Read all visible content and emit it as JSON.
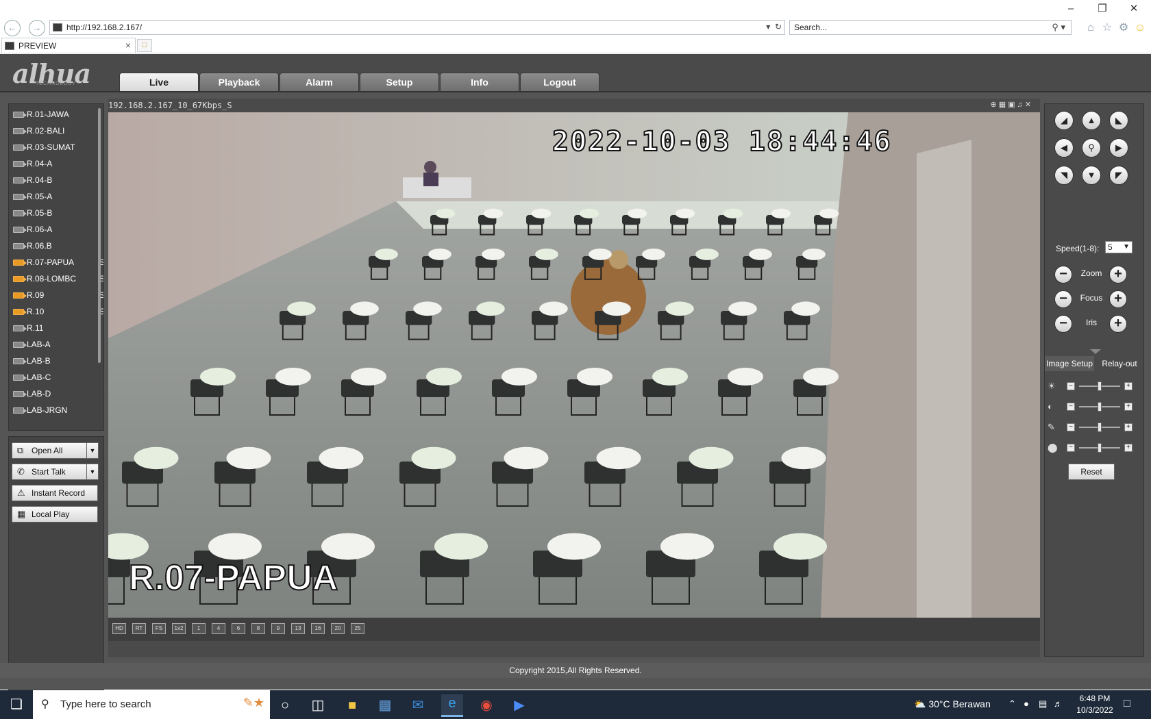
{
  "browser": {
    "url": "http://192.168.2.167/",
    "search_placeholder": "Search...",
    "tab_title": "PREVIEW"
  },
  "app": {
    "logo": "alhua",
    "logo_sub": "TECHNOLOGY",
    "menu": [
      "Live",
      "Playback",
      "Alarm",
      "Setup",
      "Info",
      "Logout"
    ],
    "active_menu": "Live",
    "channels": [
      {
        "name": "R.01-JAWA",
        "on": false,
        "flag": ""
      },
      {
        "name": "R.02-BALI",
        "on": false,
        "flag": ""
      },
      {
        "name": "R.03-SUMAT",
        "on": false,
        "flag": ""
      },
      {
        "name": "R.04-A",
        "on": false,
        "flag": ""
      },
      {
        "name": "R.04-B",
        "on": false,
        "flag": ""
      },
      {
        "name": "R.05-A",
        "on": false,
        "flag": ""
      },
      {
        "name": "R.05-B",
        "on": false,
        "flag": ""
      },
      {
        "name": "R.06-A",
        "on": false,
        "flag": ""
      },
      {
        "name": "R.06.B",
        "on": false,
        "flag": ""
      },
      {
        "name": "R.07-PAPUA",
        "on": true,
        "flag": "S"
      },
      {
        "name": "R.08-LOMBC",
        "on": true,
        "flag": "S"
      },
      {
        "name": "R.09",
        "on": true,
        "flag": "S"
      },
      {
        "name": "R.10",
        "on": true,
        "flag": "S"
      },
      {
        "name": "R.11",
        "on": false,
        "flag": ""
      },
      {
        "name": "LAB-A",
        "on": false,
        "flag": ""
      },
      {
        "name": "LAB-B",
        "on": false,
        "flag": ""
      },
      {
        "name": "LAB-C",
        "on": false,
        "flag": ""
      },
      {
        "name": "LAB-D",
        "on": false,
        "flag": ""
      },
      {
        "name": "LAB-JRGN",
        "on": false,
        "flag": ""
      }
    ],
    "buttons": {
      "open_all": "Open All",
      "start_talk": "Start Talk",
      "instant_record": "Instant Record",
      "local_play": "Local Play"
    },
    "video": {
      "stream_title": "192.168.2.167_10_67Kbps_S",
      "osd_time": "2022-10-03 18:44:46",
      "osd_name": "R.07-PAPUA"
    },
    "layout_buttons": [
      "HD",
      "RT",
      "FS",
      "1x2",
      "1",
      "4",
      "6",
      "8",
      "9",
      "13",
      "16",
      "20",
      "25"
    ],
    "ptz": {
      "speed_label": "Speed(1-8):",
      "speed_value": "5",
      "zoom_label": "Zoom",
      "focus_label": "Focus",
      "iris_label": "Iris"
    },
    "image_tabs": {
      "image_setup": "Image Setup",
      "relay_out": "Relay-out"
    },
    "image_sliders": [
      {
        "icon": "brightness-icon",
        "value": 0.5
      },
      {
        "icon": "contrast-icon",
        "value": 0.5
      },
      {
        "icon": "saturation-icon",
        "value": 0.5
      },
      {
        "icon": "hue-icon",
        "value": 0.5
      }
    ],
    "reset_label": "Reset",
    "copyright": "Copyright 2015,All Rights Reserved."
  },
  "taskbar": {
    "search_placeholder": "Type here to search",
    "weather": "30°C  Berawan",
    "time": "6:48 PM",
    "date": "10/3/2022"
  },
  "colors": {
    "app_bg": "#555555",
    "active_camera": "#e89a24",
    "taskbar": "#1e2a3a"
  }
}
